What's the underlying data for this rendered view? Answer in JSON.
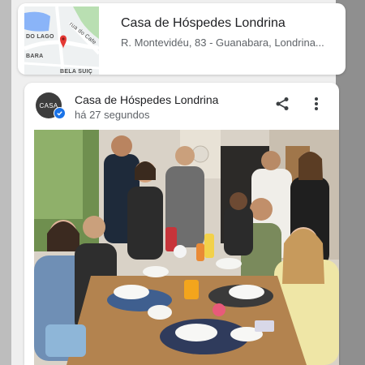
{
  "place_card": {
    "title": "Casa de Hóspedes Londrina",
    "address": "R. Montevidéu, 83 - Guanabara, Londrina...",
    "map_labels": {
      "street_top": "rua do Cafe",
      "area_left": "DO LAGO",
      "street_mid": "BARA",
      "area_bottom": "BELA SUIÇ"
    }
  },
  "post": {
    "author": "Casa de Hóspedes Londrina",
    "timestamp": "há 27 segundos",
    "avatar_text": "CASA",
    "photo_description": "group photo of guests at a breakfast table"
  },
  "colors": {
    "accent": "#1a73e8",
    "map_pin": "#e53935",
    "map_water": "#8ab4f8"
  },
  "icons": [
    "map-pin-icon",
    "verified-icon",
    "share-icon",
    "more-vert-icon"
  ]
}
